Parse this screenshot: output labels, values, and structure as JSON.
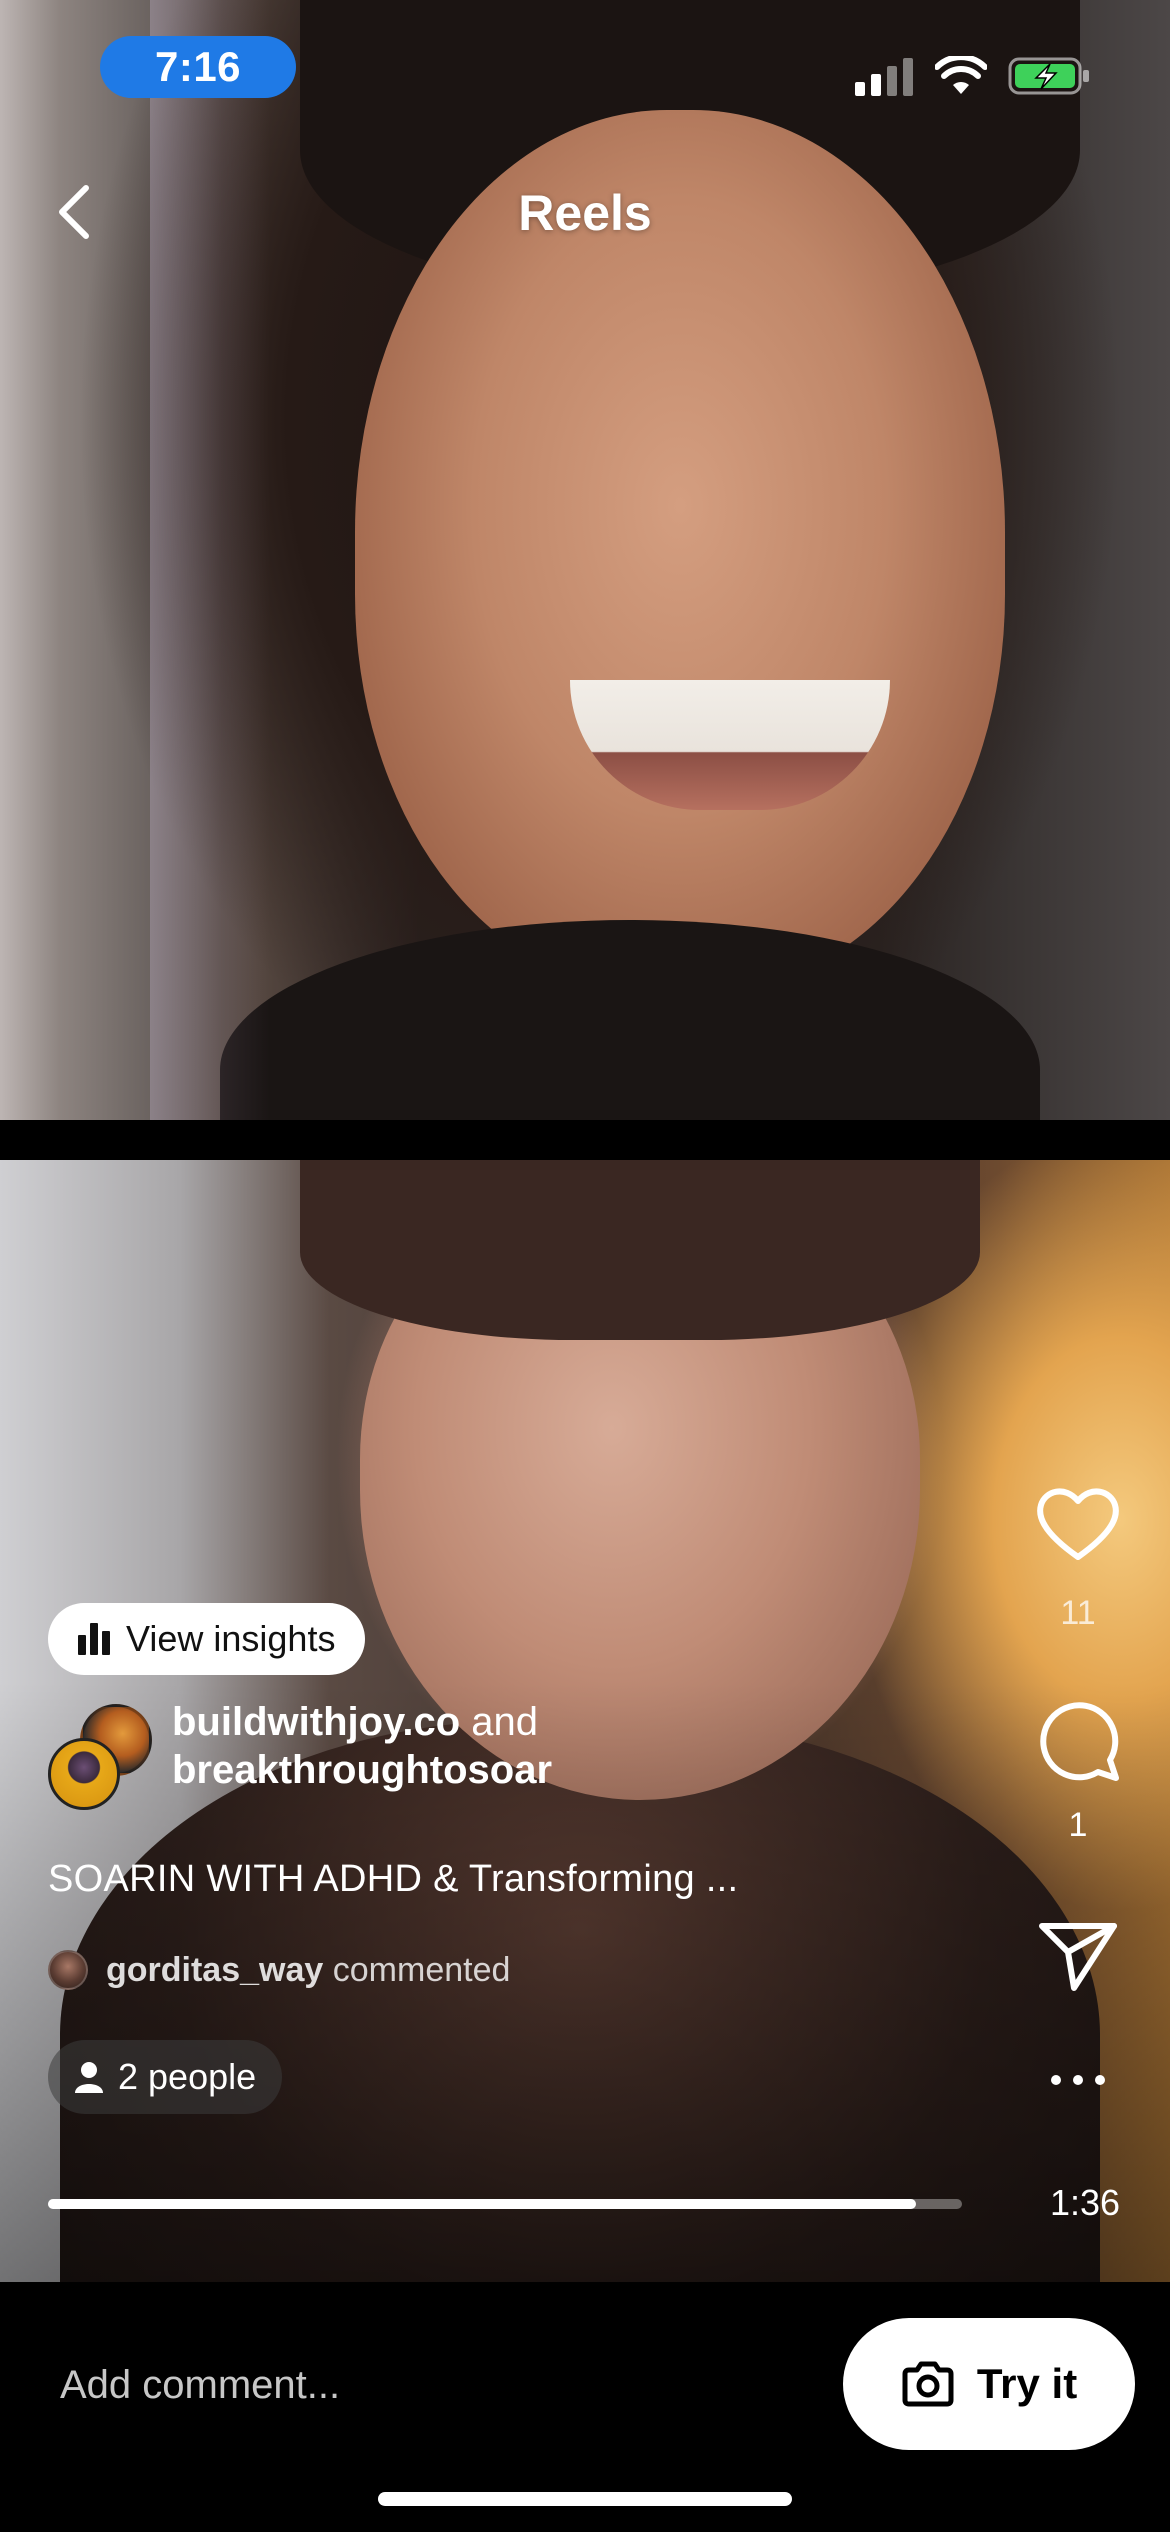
{
  "status_bar": {
    "time": "7:16",
    "signal_bars": 2,
    "battery": "charging"
  },
  "nav": {
    "title": "Reels"
  },
  "reel": {
    "insights_label": "View insights",
    "authors": {
      "primary": "buildwithjoy.co",
      "joiner": "and",
      "secondary": "breakthroughtosoar"
    },
    "caption": "SOARIN WITH ADHD & Transforming ...",
    "commenter": {
      "username": "gorditas_way",
      "action": "commented"
    },
    "people_label": "2 people",
    "progress": 0.95,
    "duration": "1:36"
  },
  "actions": {
    "likes": "11",
    "comments": "1"
  },
  "comment_bar": {
    "placeholder": "Add comment...",
    "try_label": "Try it"
  },
  "icons": [
    "back-icon",
    "heart-icon",
    "comment-icon",
    "share-icon",
    "more-icon",
    "insights-icon",
    "person-icon",
    "camera-icon",
    "wifi-icon",
    "battery-icon",
    "signal-icon"
  ]
}
